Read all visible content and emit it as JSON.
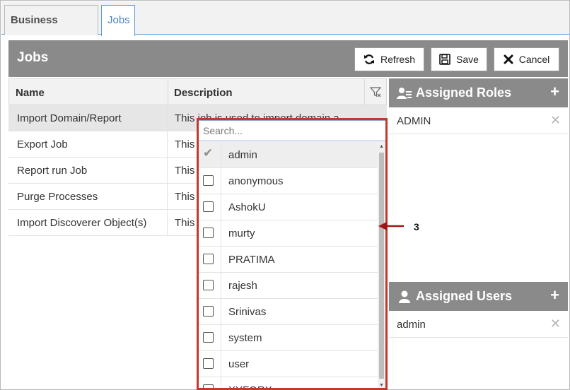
{
  "tabs": [
    {
      "label": "Business Objects",
      "active": false
    },
    {
      "label": "Jobs",
      "active": true
    }
  ],
  "jobs_panel": {
    "title": "Jobs",
    "buttons": {
      "refresh": "Refresh",
      "save": "Save",
      "cancel": "Cancel"
    }
  },
  "table": {
    "columns": [
      "Name",
      "Description"
    ],
    "rows": [
      {
        "name": "Import Domain/Report",
        "description": "This job is used to import domain a",
        "selected": true
      },
      {
        "name": "Export Job",
        "description": "This",
        "selected": false
      },
      {
        "name": "Report run Job",
        "description": "This",
        "selected": false
      },
      {
        "name": "Purge Processes",
        "description": "This",
        "selected": false
      },
      {
        "name": "Import Discoverer Object(s)",
        "description": "This",
        "selected": false
      }
    ]
  },
  "dropdown": {
    "search_placeholder": "Search...",
    "items": [
      {
        "label": "admin",
        "checked": true
      },
      {
        "label": "anonymous",
        "checked": false
      },
      {
        "label": "AshokU",
        "checked": false
      },
      {
        "label": "murty",
        "checked": false
      },
      {
        "label": "PRATIMA",
        "checked": false
      },
      {
        "label": "rajesh",
        "checked": false
      },
      {
        "label": "Srinivas",
        "checked": false
      },
      {
        "label": "system",
        "checked": false
      },
      {
        "label": "user",
        "checked": false
      },
      {
        "label": "XYFORX",
        "checked": false
      }
    ]
  },
  "assigned_roles": {
    "title": "Assigned Roles",
    "items": [
      "ADMIN"
    ]
  },
  "assigned_users": {
    "title": "Assigned Users",
    "items": [
      "admin"
    ]
  },
  "annotation": {
    "label": "3",
    "color": "#a31515"
  },
  "colors": {
    "header_bg": "#8a8a8a",
    "tab_active": "#4a86c8",
    "highlight_border": "#c0392b"
  }
}
